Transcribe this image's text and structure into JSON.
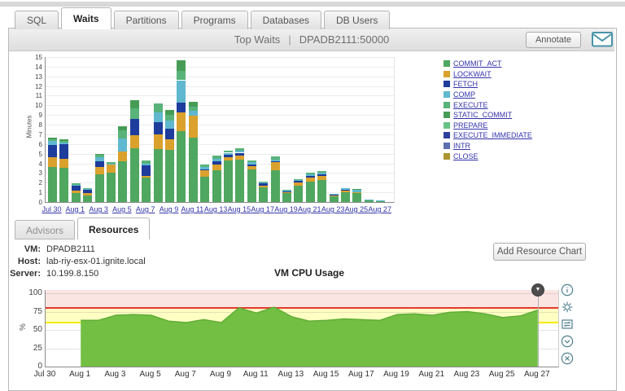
{
  "tabs": {
    "items": [
      {
        "label": "SQL",
        "active": false
      },
      {
        "label": "Waits",
        "active": true
      },
      {
        "label": "Partitions",
        "active": false
      },
      {
        "label": "Programs",
        "active": false
      },
      {
        "label": "Databases",
        "active": false
      },
      {
        "label": "DB Users",
        "active": false
      }
    ]
  },
  "header": {
    "title": "Top Waits",
    "separator": "|",
    "server": "DPADB2111:50000",
    "annotate_label": "Annotate",
    "email_icon": "envelope-icon"
  },
  "sub_tabs": {
    "items": [
      {
        "label": "Advisors",
        "active": false
      },
      {
        "label": "Resources",
        "active": true
      }
    ]
  },
  "resource_info": {
    "rows": [
      {
        "label": "VM:",
        "value": "DPADB2111"
      },
      {
        "label": "Host:",
        "value": "lab-riy-esx-01.ignite.local"
      },
      {
        "label": "Server:",
        "value": "10.199.8.150"
      }
    ],
    "add_button_label": "Add Resource Chart"
  },
  "cpu_controls": {
    "items": [
      "info",
      "settings",
      "export",
      "collapse",
      "close"
    ]
  },
  "chart_data": [
    {
      "id": "top_waits",
      "type": "bar",
      "stacked": true,
      "title": "Top Waits | DPADB2111:50000",
      "xlabel": "",
      "ylabel": "Minutes",
      "ylim": [
        0,
        15
      ],
      "y_tick_step": 1,
      "grid": true,
      "legend_position": "right",
      "categories": [
        "Jul 30",
        "Jul 31",
        "Aug 1",
        "Aug 2",
        "Aug 3",
        "Aug 4",
        "Aug 5",
        "Aug 6",
        "Aug 7",
        "Aug 8",
        "Aug 9",
        "Aug 10",
        "Aug 11",
        "Aug 12",
        "Aug 13",
        "Aug 14",
        "Aug 15",
        "Aug 16",
        "Aug 17",
        "Aug 18",
        "Aug 19",
        "Aug 20",
        "Aug 21",
        "Aug 22",
        "Aug 23",
        "Aug 24",
        "Aug 25",
        "Aug 26",
        "Aug 27"
      ],
      "x_tick_labels": [
        "Jul 30",
        "Aug 1",
        "Aug 3",
        "Aug 5",
        "Aug 7",
        "Aug 9",
        "Aug 11",
        "Aug 13",
        "Aug 15",
        "Aug 17",
        "Aug 19",
        "Aug 21",
        "Aug 23",
        "Aug 25",
        "Aug 27"
      ],
      "series": [
        {
          "name": "COMMIT_ACT",
          "color": "#4fa760",
          "values": [
            3.6,
            3.5,
            0.9,
            0.7,
            2.9,
            3.0,
            4.2,
            5.6,
            2.5,
            5.5,
            5.4,
            7.3,
            6.7,
            2.6,
            3.3,
            4.3,
            4.4,
            3.4,
            1.5,
            3.3,
            0.9,
            1.7,
            2.1,
            2.3,
            0.6,
            1.0,
            0.9,
            0.15,
            0.1
          ]
        },
        {
          "name": "LOCKWAIT",
          "color": "#dba12d",
          "values": [
            1.0,
            1.0,
            0.3,
            0.2,
            0.7,
            0.9,
            1.0,
            1.3,
            0.2,
            1.5,
            1.1,
            2.0,
            2.2,
            0.7,
            0.6,
            0.3,
            0.4,
            0.3,
            0.2,
            0.8,
            0.1,
            0.3,
            0.4,
            0.4,
            0.1,
            0.2,
            0.1,
            0,
            0
          ]
        },
        {
          "name": "FETCH",
          "color": "#1d3c9c",
          "values": [
            1.3,
            1.5,
            0.5,
            0.4,
            0.6,
            0,
            0,
            1.7,
            1.1,
            1.3,
            1.1,
            1.0,
            0,
            0.1,
            0.3,
            0.3,
            0.3,
            0.2,
            0.2,
            0.1,
            0.1,
            0.2,
            0.2,
            0.2,
            0.1,
            0.1,
            0.05,
            0,
            0
          ]
        },
        {
          "name": "COMP",
          "color": "#5fb8cf",
          "values": [
            0.4,
            0.15,
            0.1,
            0.05,
            0.4,
            0.1,
            1.4,
            0,
            0.2,
            1.0,
            0.8,
            2.3,
            0.5,
            0.2,
            0.3,
            0.2,
            0.2,
            0.2,
            0.1,
            0.2,
            0.05,
            0.1,
            0.15,
            0.15,
            0.05,
            0.1,
            0.2,
            0.05,
            0.05
          ]
        },
        {
          "name": "EXECUTE",
          "color": "#58b37a",
          "values": [
            0.2,
            0.15,
            0.1,
            0.05,
            0.3,
            0.1,
            0.8,
            1.1,
            0.3,
            0.9,
            0.6,
            1.0,
            0.5,
            0.3,
            0.3,
            0.2,
            0.3,
            0.2,
            0.1,
            0.3,
            0.05,
            0.1,
            0.15,
            0.15,
            0,
            0,
            0,
            0,
            0
          ]
        },
        {
          "name": "STATIC_COMMIT",
          "color": "#479c55",
          "values": [
            0.2,
            0.2,
            0,
            0,
            0.1,
            0,
            0.4,
            0.8,
            0,
            0,
            0.5,
            1.1,
            0.5,
            0,
            0,
            0,
            0,
            0,
            0,
            0,
            0,
            0,
            0,
            0,
            0,
            0,
            0.05,
            0,
            0
          ]
        },
        {
          "name": "PREPARE",
          "color": "#66c385",
          "values": []
        },
        {
          "name": "EXECUTE_IMMEDIATE",
          "color": "#303e9c",
          "values": []
        },
        {
          "name": "INTR",
          "color": "#5c70b2",
          "values": []
        },
        {
          "name": "CLOSE",
          "color": "#ad9530",
          "values": []
        }
      ]
    },
    {
      "id": "vm_cpu_usage",
      "type": "area",
      "title": "VM CPU Usage",
      "xlabel": "",
      "ylabel": "%",
      "ylim": [
        0,
        104
      ],
      "y_ticks": [
        0,
        25,
        50,
        75,
        100
      ],
      "grid": true,
      "x": [
        "Aug 1",
        "Aug 2",
        "Aug 3",
        "Aug 4",
        "Aug 5",
        "Aug 6",
        "Aug 7",
        "Aug 8",
        "Aug 9",
        "Aug 10",
        "Aug 11",
        "Aug 12",
        "Aug 13",
        "Aug 14",
        "Aug 15",
        "Aug 16",
        "Aug 17",
        "Aug 18",
        "Aug 19",
        "Aug 20",
        "Aug 21",
        "Aug 22",
        "Aug 23",
        "Aug 24",
        "Aug 25",
        "Aug 26",
        "Aug 27"
      ],
      "values": [
        63,
        63,
        70,
        71,
        70,
        62,
        60,
        64,
        60,
        80,
        73,
        81,
        68,
        62,
        63,
        65,
        64,
        63,
        71,
        72,
        70,
        74,
        75,
        72,
        67,
        69,
        77
      ],
      "x_tick_labels": [
        "Jul 30",
        "Aug 1",
        "Aug 3",
        "Aug 5",
        "Aug 7",
        "Aug 9",
        "Aug 11",
        "Aug 13",
        "Aug 15",
        "Aug 17",
        "Aug 19",
        "Aug 21",
        "Aug 23",
        "Aug 25",
        "Aug 27"
      ],
      "x_axis_start": "Jul 30",
      "area_color": "#72bf44",
      "area_edge_color": "#61ad38",
      "thresholds": {
        "critical_line": 80,
        "critical_line_color": "#e23b2e",
        "critical_band_color": "#fbe5e3",
        "warning_line": 60,
        "warning_line_color": "#f7ea00",
        "warning_band_color": "#ffffc4"
      },
      "marker_at": "Aug 27"
    }
  ]
}
